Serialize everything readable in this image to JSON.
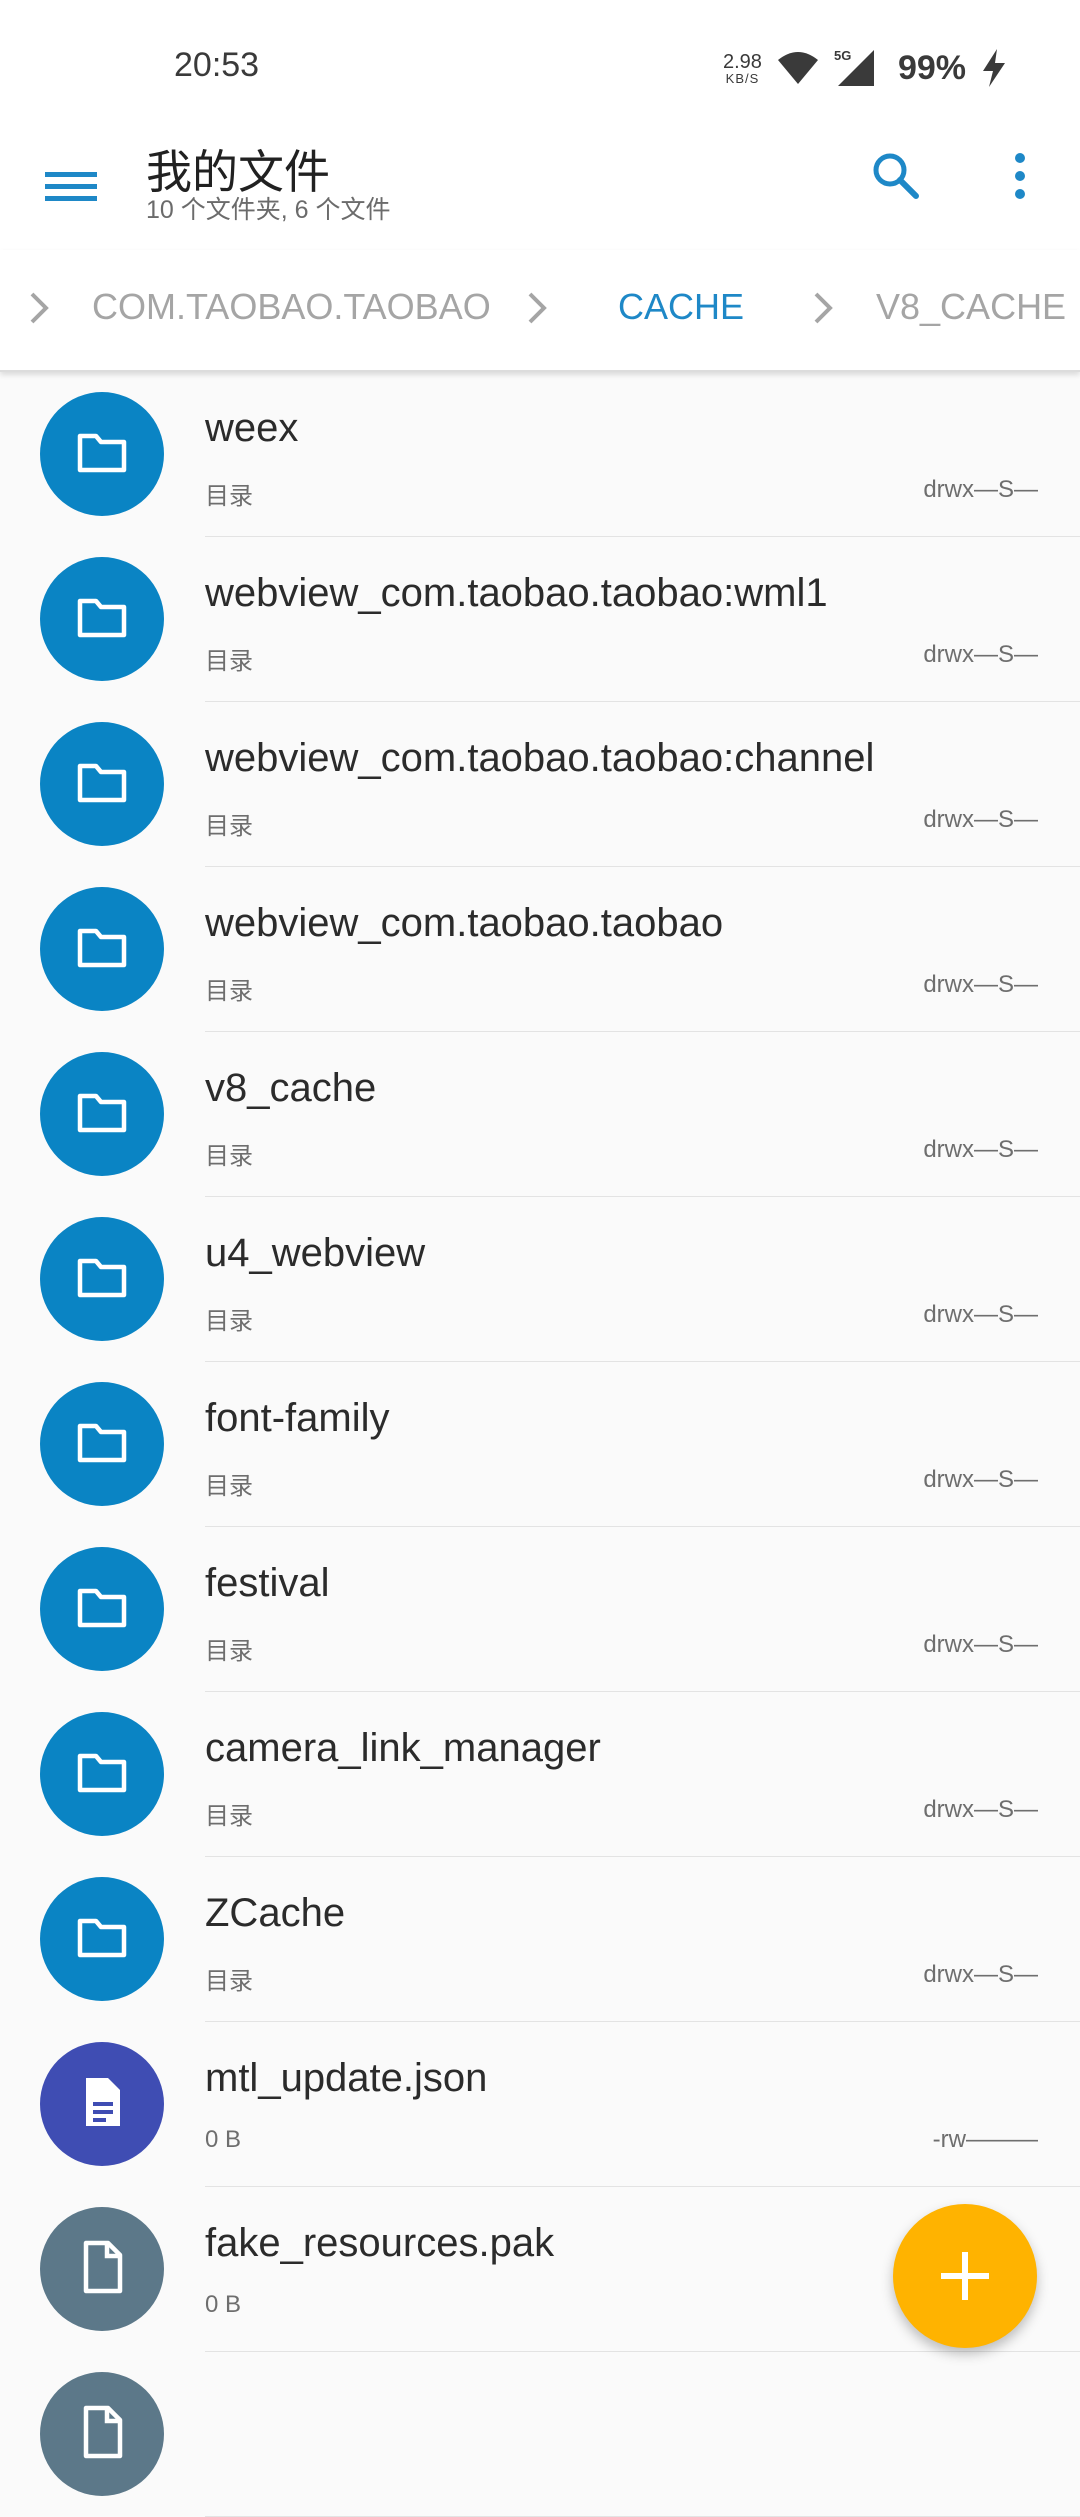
{
  "status_bar": {
    "time": "20:53",
    "net_speed_value": "2.98",
    "net_speed_unit": "KB/S",
    "network_type": "5G",
    "battery_percent": "99%"
  },
  "app_bar": {
    "title": "我的文件",
    "subtitle": "10 个文件夹, 6 个文件"
  },
  "breadcrumb": {
    "items": [
      "COM.TAOBAO.TAOBAO",
      "CACHE",
      "V8_CACHE"
    ]
  },
  "colors": {
    "folder": "#0a84c4",
    "json_file": "#3f4db3",
    "generic_file": "#5c7889",
    "accent": "#1e88c7",
    "fab": "#ffb300"
  },
  "files": [
    {
      "name": "weex",
      "meta": "目录",
      "perm": "drwx—S—",
      "icon": "folder-icon"
    },
    {
      "name": "webview_com.taobao.taobao:wml1",
      "meta": "目录",
      "perm": "drwx—S—",
      "icon": "folder-icon"
    },
    {
      "name": "webview_com.taobao.taobao:channel",
      "meta": "目录",
      "perm": "drwx—S—",
      "icon": "folder-icon"
    },
    {
      "name": "webview_com.taobao.taobao",
      "meta": "目录",
      "perm": "drwx—S—",
      "icon": "folder-icon"
    },
    {
      "name": "v8_cache",
      "meta": "目录",
      "perm": "drwx—S—",
      "icon": "folder-icon"
    },
    {
      "name": "u4_webview",
      "meta": "目录",
      "perm": "drwx—S—",
      "icon": "folder-icon"
    },
    {
      "name": "font-family",
      "meta": "目录",
      "perm": "drwx—S—",
      "icon": "folder-icon"
    },
    {
      "name": "festival",
      "meta": "目录",
      "perm": "drwx—S—",
      "icon": "folder-icon"
    },
    {
      "name": "camera_link_manager",
      "meta": "目录",
      "perm": "drwx—S—",
      "icon": "folder-icon"
    },
    {
      "name": "ZCache",
      "meta": "目录",
      "perm": "drwx—S—",
      "icon": "folder-icon"
    },
    {
      "name": "mtl_update.json",
      "meta": "0 B",
      "perm": "-rw———",
      "icon": "text-file-icon"
    },
    {
      "name": "fake_resources.pak",
      "meta": "0 B",
      "perm": "",
      "icon": "file-icon"
    },
    {
      "name": "",
      "meta": "",
      "perm": "",
      "icon": "file-icon"
    }
  ],
  "fab_icon": "plus-icon"
}
